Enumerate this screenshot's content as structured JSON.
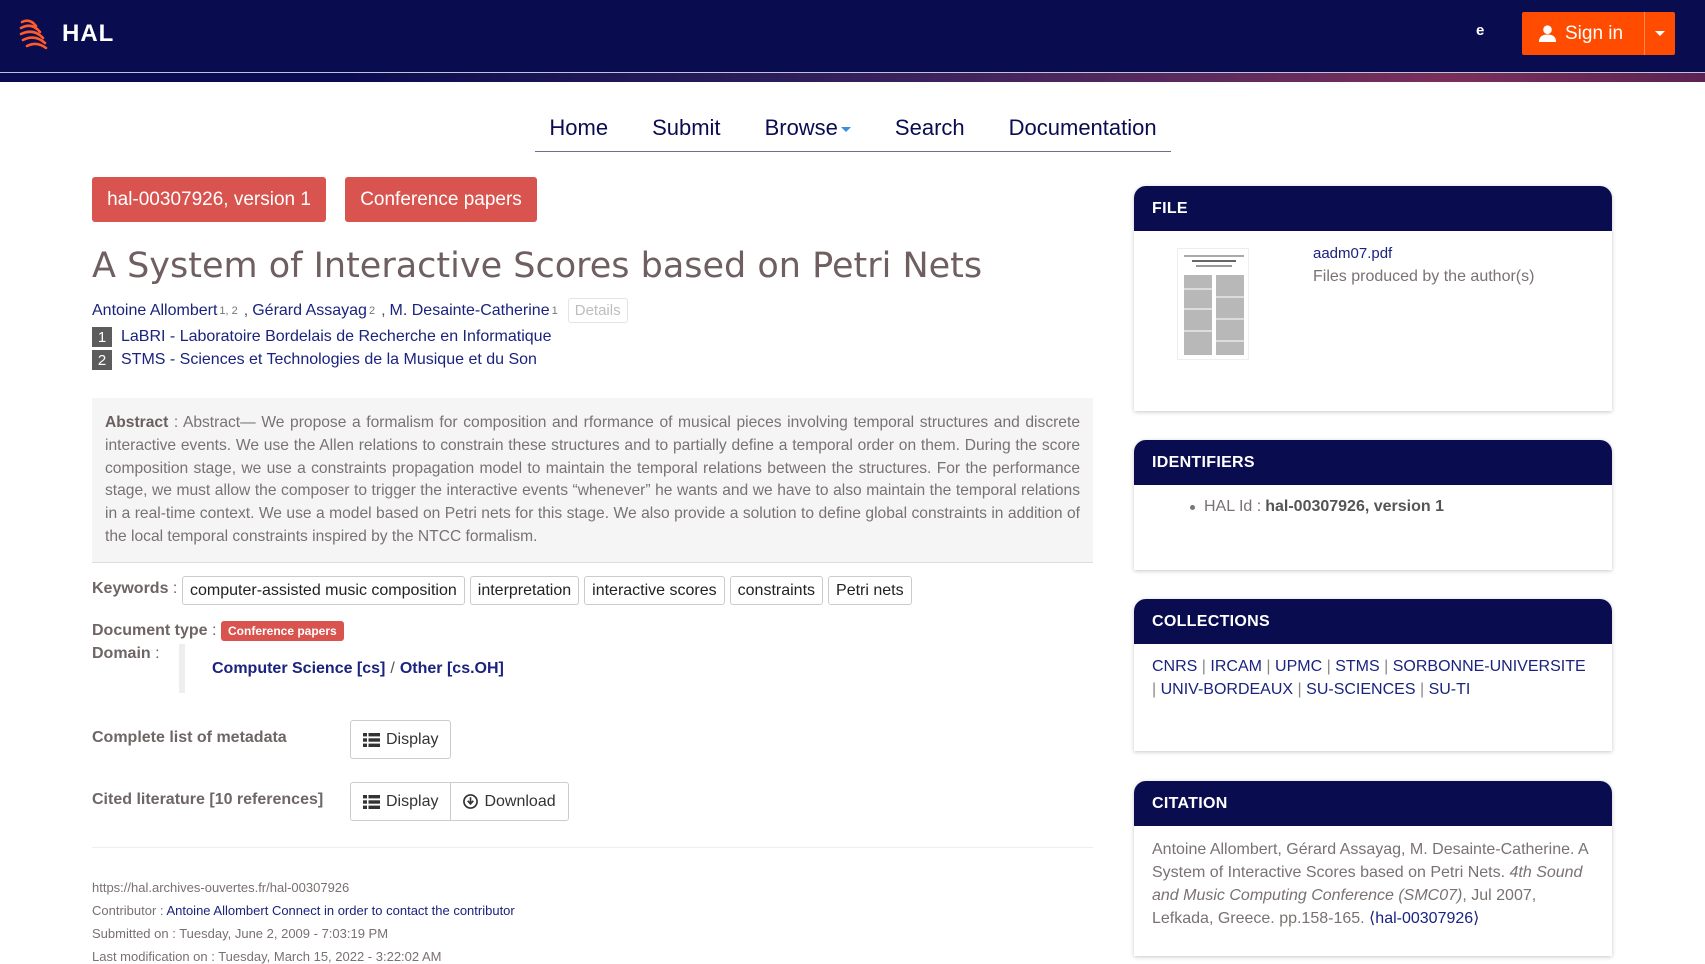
{
  "header": {
    "logo_text": "HAL",
    "lang_letter": "e",
    "signin_label": "Sign in"
  },
  "nav": {
    "items": [
      "Home",
      "Submit",
      "Browse",
      "Search",
      "Documentation"
    ]
  },
  "doc": {
    "id_badge": "hal-00307926, version 1",
    "type_badge": "Conference papers",
    "title": "A System of Interactive Scores based on Petri Nets",
    "authors": [
      {
        "name": "Antoine Allombert",
        "sup": "1, 2"
      },
      {
        "name": "Gérard Assayag",
        "sup": "2"
      },
      {
        "name": "M. Desainte-Catherine",
        "sup": "1"
      }
    ],
    "author_sep": ",",
    "details_label": "Details",
    "affiliations": [
      {
        "num": "1",
        "name": "LaBRI - Laboratoire Bordelais de Recherche en Informatique"
      },
      {
        "num": "2",
        "name": "STMS - Sciences et Technologies de la Musique et du Son"
      }
    ],
    "abstract_label": "Abstract",
    "abstract_sep": " : ",
    "abstract_text": "Abstract— We propose a formalism for composition and rformance of musical pieces involving temporal structures and discrete interactive events. We use the Allen relations to constrain these structures and to partially define a temporal order on them. During the score composition stage, we use a constraints propagation model to maintain the temporal relations between the structures. For the performance stage, we must allow the composer to trigger the interactive events “whenever” he wants and we have to also maintain the temporal relations in a real-time context. We use a model based on Petri nets for this stage. We also provide a solution to define global constraints in addition of the local temporal constraints inspired by the NTCC formalism.",
    "keywords_label": "Keywords",
    "keywords": [
      "computer-assisted music composition",
      "interpretation",
      "interactive scores",
      "constraints",
      "Petri nets"
    ],
    "doctype_label": "Document type",
    "doctype_value": "Conference papers",
    "domain_label": "Domain",
    "domain_main": "Computer Science [cs]",
    "domain_slash": "/",
    "domain_sub": "Other [cs.OH]",
    "colon": " :",
    "metadata_label": "Complete list of metadata",
    "display_label": "Display",
    "cited_label": "Cited literature [10 references]",
    "download_label": "Download",
    "url": "https://hal.archives-ouvertes.fr/hal-00307926",
    "contributor_label": "Contributor : ",
    "contributor_value": "Antoine Allombert Connect in order to contact the contributor",
    "submitted": "Submitted on : Tuesday, June 2, 2009 - 7:03:19 PM",
    "last_modified": "Last modification on : Tuesday, March 15, 2022 - 3:22:02 AM"
  },
  "sidebar": {
    "file_title": "FILE",
    "file_name": "aadm07.pdf",
    "file_sub": "Files produced by the author(s)",
    "identifiers_title": "IDENTIFIERS",
    "hal_id_label": "HAL Id :",
    "hal_id_value": "hal-00307926, version 1",
    "collections_title": "COLLECTIONS",
    "collections": [
      "CNRS",
      "IRCAM",
      "UPMC",
      "STMS",
      "SORBONNE-UNIVERSITE",
      "UNIV-BORDEAUX",
      "SU-SCIENCES",
      "SU-TI"
    ],
    "collection_sep": "|",
    "citation_title": "CITATION",
    "citation_plain": "Antoine Allombert, Gérard Assayag, M. Desainte-Catherine. A System of Interactive Scores based on Petri Nets.",
    "citation_italic": "4th Sound and Music Computing Conference (SMC07)",
    "citation_rest": ", Jul 2007, Lefkada, Greece. pp.158-165.",
    "citation_link": "⟨hal-00307926⟩"
  },
  "colors": {
    "navy": "#0a0c50",
    "orange": "#ff4c00",
    "red_badge": "#d9534f",
    "link": "#1a237e"
  }
}
